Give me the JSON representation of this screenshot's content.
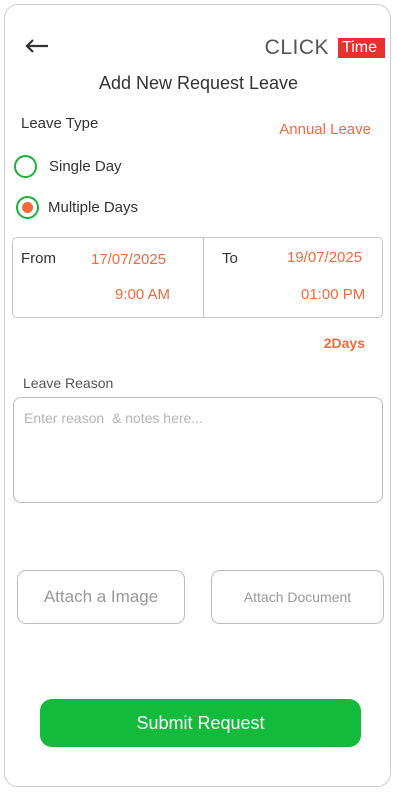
{
  "header": {
    "logo_click": "CLICK",
    "logo_time": "Time",
    "title": "Add New Request Leave"
  },
  "leave_type": {
    "label": "Leave Type",
    "value": "Annual Leave"
  },
  "duration": {
    "options": [
      "Single Day",
      "Multiple Days"
    ],
    "selected": "Multiple Days"
  },
  "dates": {
    "from_label": "From",
    "from_date": "17/07/2025",
    "from_time": "9:00 AM",
    "to_label": "To",
    "to_date": "19/07/2025",
    "to_time": "01:00 PM"
  },
  "days_count": "2Days",
  "reason": {
    "label": "Leave Reason",
    "placeholder": "Enter reason  & notes here...",
    "value": ""
  },
  "attachments": {
    "image_label": "Attach a Image",
    "document_label": "Attach Document"
  },
  "submit_label": "Submit Request",
  "colors": {
    "accent_orange": "#f26a3d",
    "primary_green": "#12bb3c",
    "brand_red": "#e8312f"
  }
}
